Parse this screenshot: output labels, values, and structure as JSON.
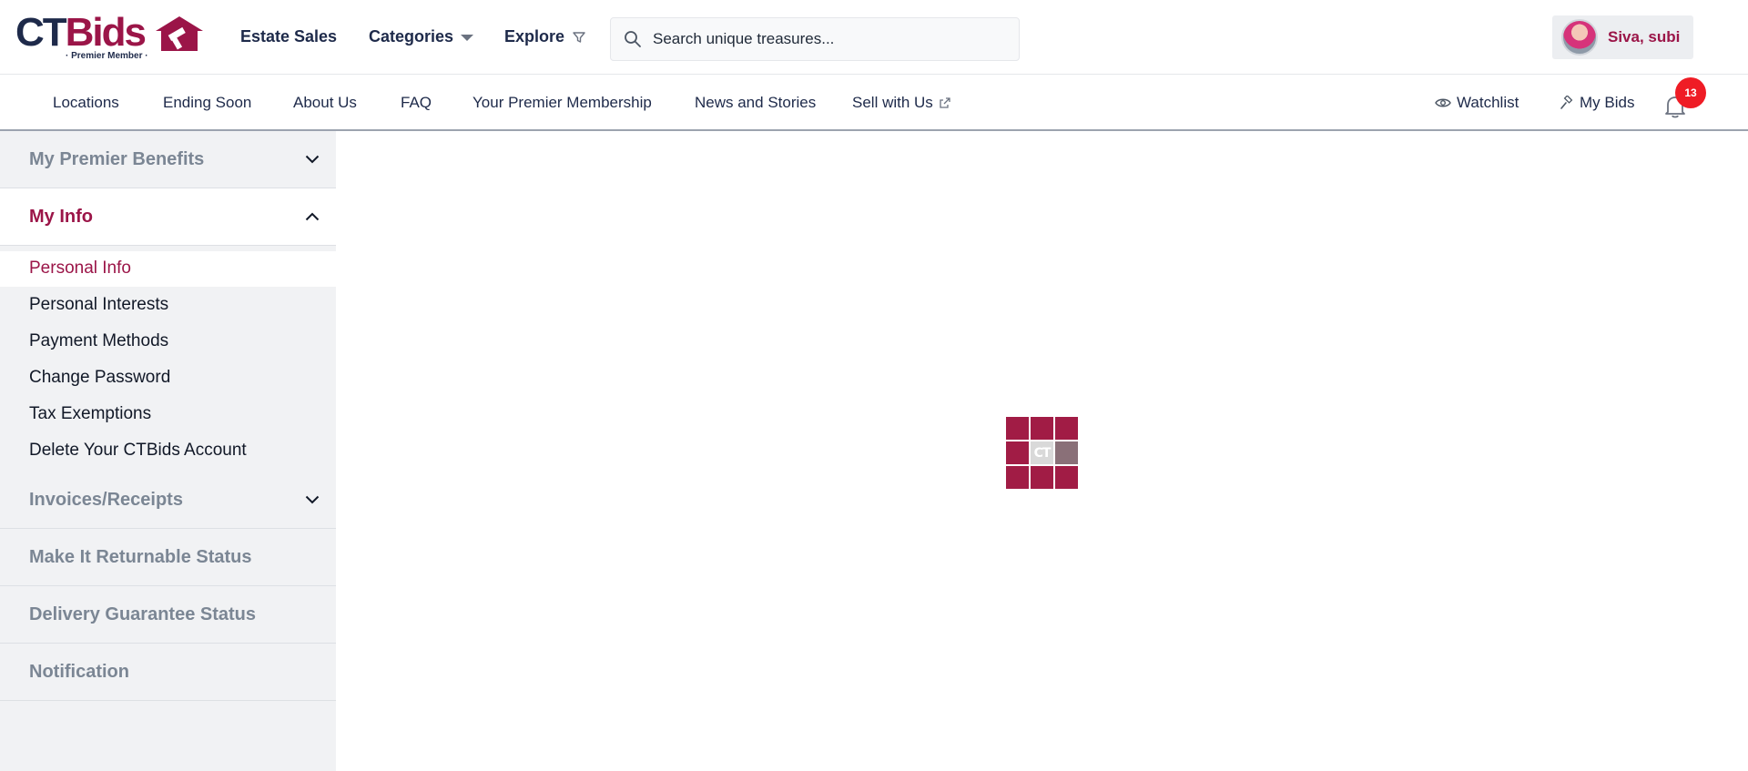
{
  "header": {
    "logo_ct": "CT",
    "logo_bids": "Bids",
    "logo_sub": "· Premier Member ·",
    "nav": [
      {
        "label": "Estate Sales"
      },
      {
        "label": "Categories"
      },
      {
        "label": "Explore"
      }
    ],
    "search_placeholder": "Search unique treasures...",
    "user_name": "Siva, subi"
  },
  "subnav": {
    "items": [
      {
        "label": "Locations"
      },
      {
        "label": "Ending Soon"
      },
      {
        "label": "About Us"
      },
      {
        "label": "FAQ"
      },
      {
        "label": "Your Premier Membership"
      },
      {
        "label": "News and Stories"
      },
      {
        "label": "Sell with Us"
      }
    ],
    "watchlist": "Watchlist",
    "my_bids": "My Bids",
    "notification_count": "13"
  },
  "sidebar": {
    "sections": [
      {
        "title": "My Premier Benefits"
      },
      {
        "title": "My Info"
      },
      {
        "title": "Invoices/Receipts"
      },
      {
        "title": "Make It Returnable Status"
      },
      {
        "title": "Delivery Guarantee Status"
      },
      {
        "title": "Notification"
      }
    ],
    "my_info_items": [
      {
        "label": "Personal Info"
      },
      {
        "label": "Personal Interests"
      },
      {
        "label": "Payment Methods"
      },
      {
        "label": "Change Password"
      },
      {
        "label": "Tax Exemptions"
      },
      {
        "label": "Delete Your CTBids Account"
      }
    ]
  },
  "loader": {
    "label": "CT"
  },
  "colors": {
    "brand": "#9b1548",
    "navy": "#1e2a4a",
    "badge": "#ef1c25",
    "sidebar_bg": "#f1f2f4",
    "muted": "#7b8694"
  }
}
